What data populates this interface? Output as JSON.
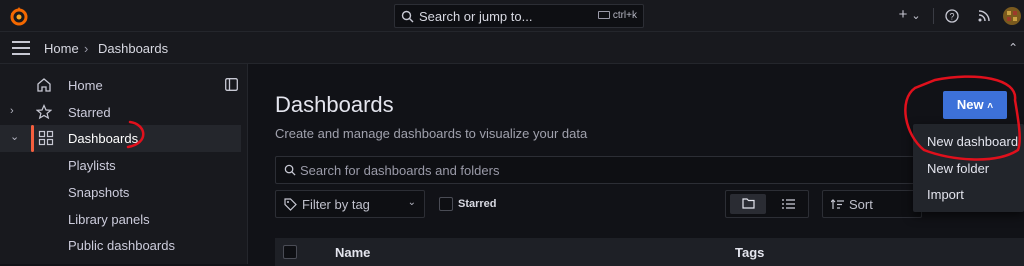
{
  "topbar": {
    "search_placeholder": "Search or jump to...",
    "shortcut": "ctrl+k",
    "add_icon": "plus-icon",
    "add_chevron": "⌄",
    "help_icon": "help-icon",
    "news_icon": "rss-icon",
    "avatar_icon": "avatar"
  },
  "breadcrumb": {
    "home": "Home",
    "separator": "›",
    "current": "Dashboards"
  },
  "sidebar": {
    "items": [
      {
        "label": "Home",
        "icon": "home-icon"
      },
      {
        "label": "Starred",
        "icon": "star-icon",
        "chevron": "›"
      },
      {
        "label": "Dashboards",
        "icon": "apps-icon",
        "chevron": "⌄"
      },
      {
        "label": "Playlists"
      },
      {
        "label": "Snapshots"
      },
      {
        "label": "Library panels"
      },
      {
        "label": "Public dashboards"
      }
    ]
  },
  "main": {
    "title": "Dashboards",
    "subtitle": "Create and manage dashboards to visualize your data",
    "search_placeholder": "Search for dashboards and folders",
    "filter_placeholder": "Filter by tag",
    "starred_label": "Starred",
    "sort_placeholder": "Sort",
    "table_headers": {
      "name": "Name",
      "tags": "Tags"
    }
  },
  "new_button": {
    "label": "New",
    "caret": "˄"
  },
  "new_menu": {
    "items": [
      "New dashboard",
      "New folder",
      "Import"
    ]
  },
  "colors": {
    "accent": "#3d71d9",
    "active_bar": "#f55f3e",
    "annotation": "#e0101c"
  }
}
